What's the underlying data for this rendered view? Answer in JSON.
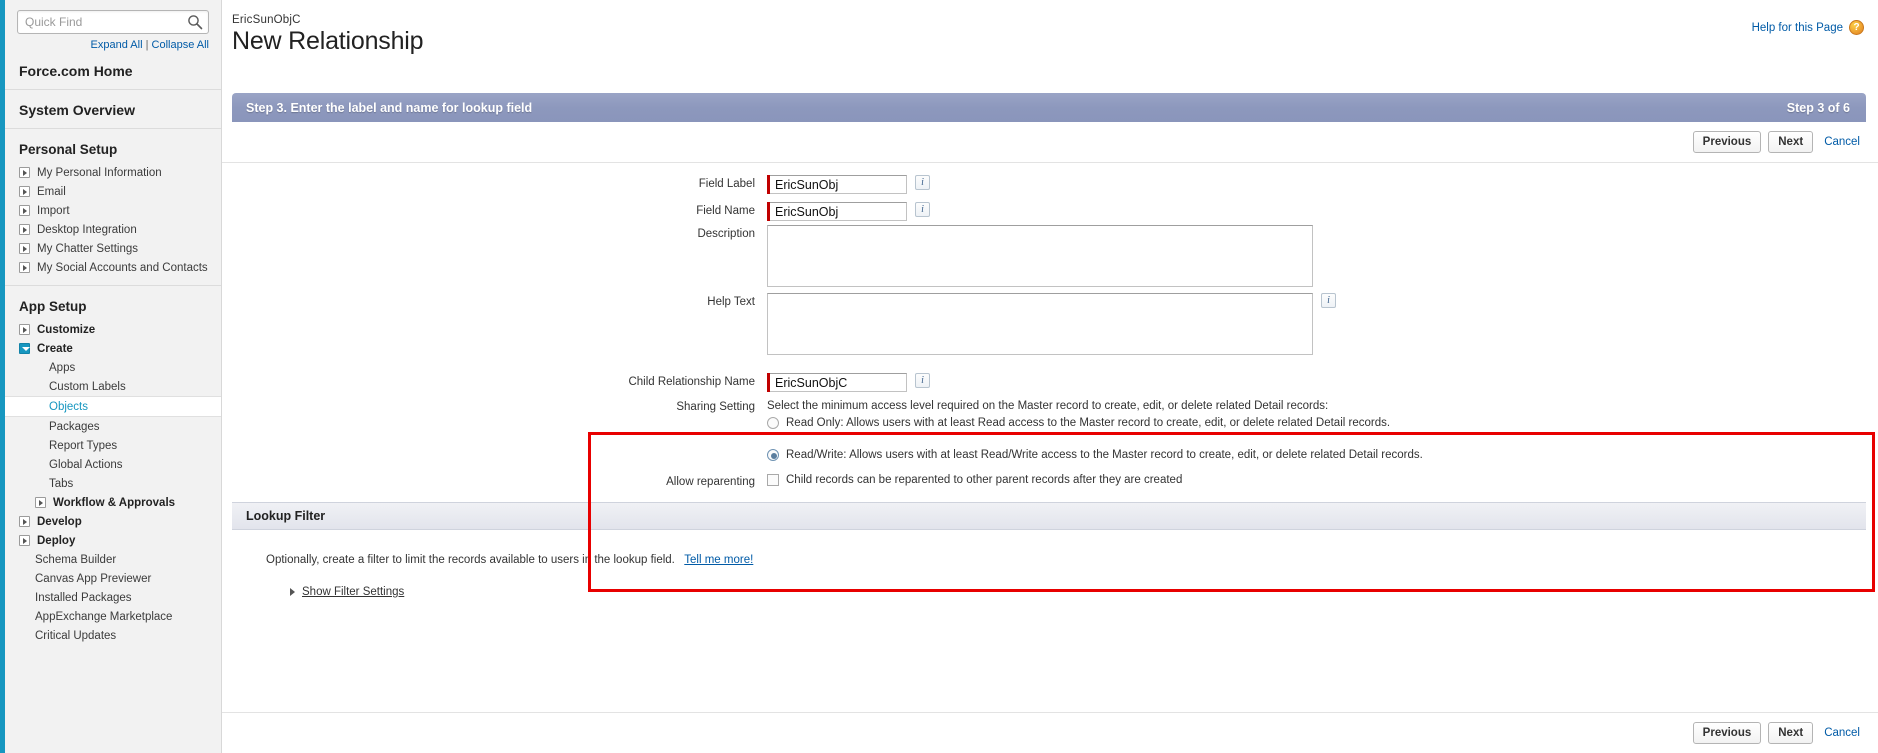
{
  "sidebar": {
    "search": {
      "placeholder": "Quick Find",
      "value": "",
      "icon": "search-icon"
    },
    "expand_all": "Expand All",
    "separator": "|",
    "collapse_all": "Collapse All",
    "home_label": "Force.com Home",
    "system_overview_label": "System Overview",
    "personal_setup": {
      "title": "Personal Setup",
      "items": [
        {
          "label": "My Personal Information",
          "expandable": true
        },
        {
          "label": "Email",
          "expandable": true
        },
        {
          "label": "Import",
          "expandable": true
        },
        {
          "label": "Desktop Integration",
          "expandable": true
        },
        {
          "label": "My Chatter Settings",
          "expandable": true
        },
        {
          "label": "My Social Accounts and Contacts",
          "expandable": true
        }
      ]
    },
    "app_setup": {
      "title": "App Setup",
      "items": [
        {
          "label": "Customize",
          "expandable": true,
          "open": false
        },
        {
          "label": "Create",
          "expandable": true,
          "open": true
        },
        {
          "label": "Apps",
          "child": true
        },
        {
          "label": "Custom Labels",
          "child": true
        },
        {
          "label": "Objects",
          "child": true,
          "selected": true
        },
        {
          "label": "Packages",
          "child": true
        },
        {
          "label": "Report Types",
          "child": true
        },
        {
          "label": "Global Actions",
          "child": true
        },
        {
          "label": "Tabs",
          "child": true
        },
        {
          "label": "Workflow & Approvals",
          "child": true,
          "expandable": true
        },
        {
          "label": "Develop",
          "expandable": true
        },
        {
          "label": "Deploy",
          "expandable": true
        },
        {
          "label": "Schema Builder"
        },
        {
          "label": "Canvas App Previewer"
        },
        {
          "label": "Installed Packages"
        },
        {
          "label": "AppExchange Marketplace"
        },
        {
          "label": "Critical Updates"
        }
      ]
    }
  },
  "header": {
    "breadcrumb": "EricSunObjC",
    "title": "New Relationship",
    "help_label": "Help for this Page",
    "help_icon": "help-question-icon"
  },
  "step": {
    "title": "Step 3. Enter the label and name for lookup field",
    "counter": "Step 3 of 6"
  },
  "toolbar": {
    "previous_label": "Previous",
    "next_label": "Next",
    "cancel_label": "Cancel"
  },
  "form": {
    "field_label": {
      "label": "Field Label",
      "value": "EricSunObj",
      "required": true,
      "info_icon": "info-icon"
    },
    "field_name": {
      "label": "Field Name",
      "value": "EricSunObj",
      "required": true,
      "info_icon": "info-icon"
    },
    "description": {
      "label": "Description",
      "value": ""
    },
    "help_text": {
      "label": "Help Text",
      "value": "",
      "info_icon": "info-icon"
    },
    "child_relationship_name": {
      "label": "Child Relationship Name",
      "value": "EricSunObjC",
      "required": true,
      "info_icon": "info-icon"
    },
    "sharing_setting": {
      "label": "Sharing Setting",
      "intro": "Select the minimum access level required on the Master record to create, edit, or delete related Detail records:",
      "options": [
        {
          "label": "Read Only: Allows users with at least Read access to the Master record to create, edit, or delete related Detail records.",
          "selected": false
        },
        {
          "label": "Read/Write: Allows users with at least Read/Write access to the Master record to create, edit, or delete related Detail records.",
          "selected": true
        }
      ]
    },
    "allow_reparenting": {
      "label": "Allow reparenting",
      "checkbox_label": "Child records can be reparented to other parent records after they are created",
      "checked": false
    }
  },
  "lookup_filter": {
    "section_title": "Lookup Filter",
    "description": "Optionally, create a filter to limit the records available to users in the lookup field.",
    "tell_me_more": "Tell me more!",
    "show_filter_settings": "Show Filter Settings"
  },
  "colors": {
    "accent": "#1797c0",
    "step_bar": "#8d98bd",
    "highlight_border": "#e80000",
    "required_marker": "#c00000",
    "link": "#015ba7"
  }
}
